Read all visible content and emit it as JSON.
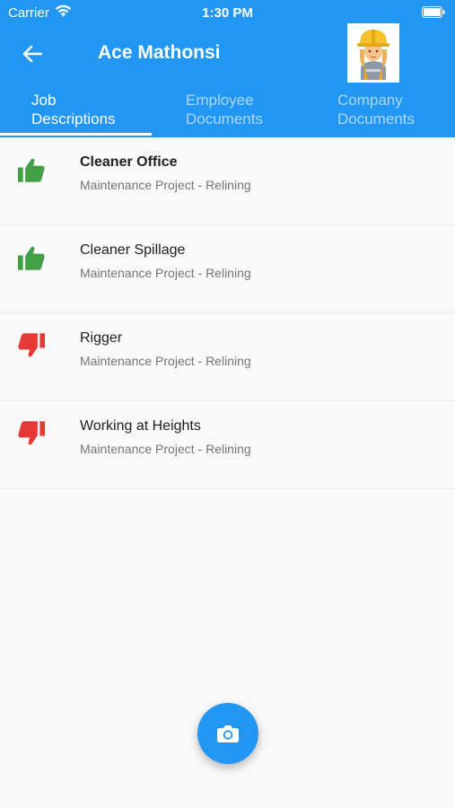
{
  "status_bar": {
    "carrier": "Carrier",
    "time": "1:30 PM"
  },
  "header": {
    "title": "Ace Mathonsi",
    "back_icon": "arrow-left-icon",
    "avatar": "construction-worker-avatar"
  },
  "tabs": [
    {
      "line1": "Job",
      "line2": "Descriptions",
      "active": true
    },
    {
      "line1": "Employee",
      "line2": "Documents",
      "active": false
    },
    {
      "line1": "Company",
      "line2": "Documents",
      "active": false
    }
  ],
  "jobs": [
    {
      "title": "Cleaner Office",
      "subtitle": "Maintenance Project - Relining",
      "status": "thumbs-up",
      "bold": true
    },
    {
      "title": "Cleaner Spillage",
      "subtitle": "Maintenance Project - Relining",
      "status": "thumbs-up",
      "bold": false
    },
    {
      "title": "Rigger",
      "subtitle": "Maintenance Project - Relining",
      "status": "thumbs-down",
      "bold": false
    },
    {
      "title": "Working at Heights",
      "subtitle": "Maintenance Project - Relining",
      "status": "thumbs-down",
      "bold": false
    }
  ],
  "colors": {
    "primary": "#2196f3",
    "approved": "#43a047",
    "rejected": "#e53935",
    "background": "#f9f9f9"
  },
  "fab": {
    "icon": "camera-icon"
  }
}
